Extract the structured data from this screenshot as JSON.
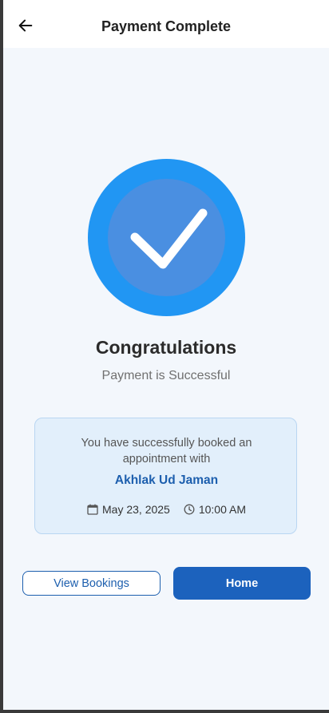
{
  "header": {
    "title": "Payment Complete",
    "back_icon": "arrow-left-icon"
  },
  "status": {
    "icon": "check-icon",
    "colors": {
      "outer": "#2196f3",
      "inner": "#4a8fe1"
    },
    "heading": "Congratulations",
    "message": "Payment is Successful"
  },
  "booking": {
    "intro": "You have successfully booked an appointment with",
    "doctor_name": "Akhlak Ud Jaman",
    "date": "May 23, 2025",
    "time": "10:00 AM",
    "date_icon": "calendar-icon",
    "time_icon": "clock-icon"
  },
  "actions": {
    "view_bookings_label": "View Bookings",
    "home_label": "Home"
  },
  "colors": {
    "accent": "#1c62bd",
    "card_bg": "#e2effb",
    "page_bg": "#f3f7fc"
  }
}
